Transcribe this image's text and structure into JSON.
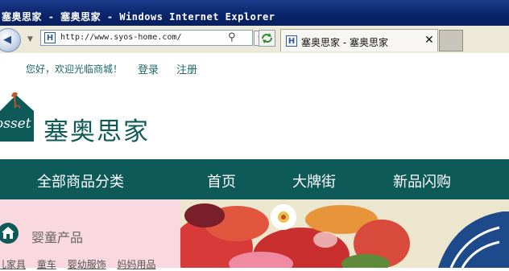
{
  "window": {
    "title": "塞奥思家 - 塞奥思家 - Windows Internet Explorer"
  },
  "browser": {
    "address_url": "http://www.syos-home.com/",
    "tab_title": "塞奥思家 - 塞奥思家",
    "tab_close": "✕",
    "site_icon_letter": "H"
  },
  "topbar": {
    "welcome": "您好，欢迎光临商城！",
    "login": "登录",
    "register": "注册"
  },
  "header": {
    "logo_badge_text": "osset",
    "logo_text": "塞奥思家"
  },
  "nav": {
    "items": [
      "全部商品分类",
      "首页",
      "大牌街",
      "新品闪购"
    ]
  },
  "categories": {
    "heading": "婴童产品",
    "links": [
      "儿家具",
      "童车",
      "婴幼服饰",
      "妈妈用品"
    ]
  },
  "colors": {
    "brand_teal": "#0e5a58",
    "link_teal": "#1b6a68",
    "category_pink": "#f9d9df",
    "titlebar_blue": "#0a246a"
  }
}
